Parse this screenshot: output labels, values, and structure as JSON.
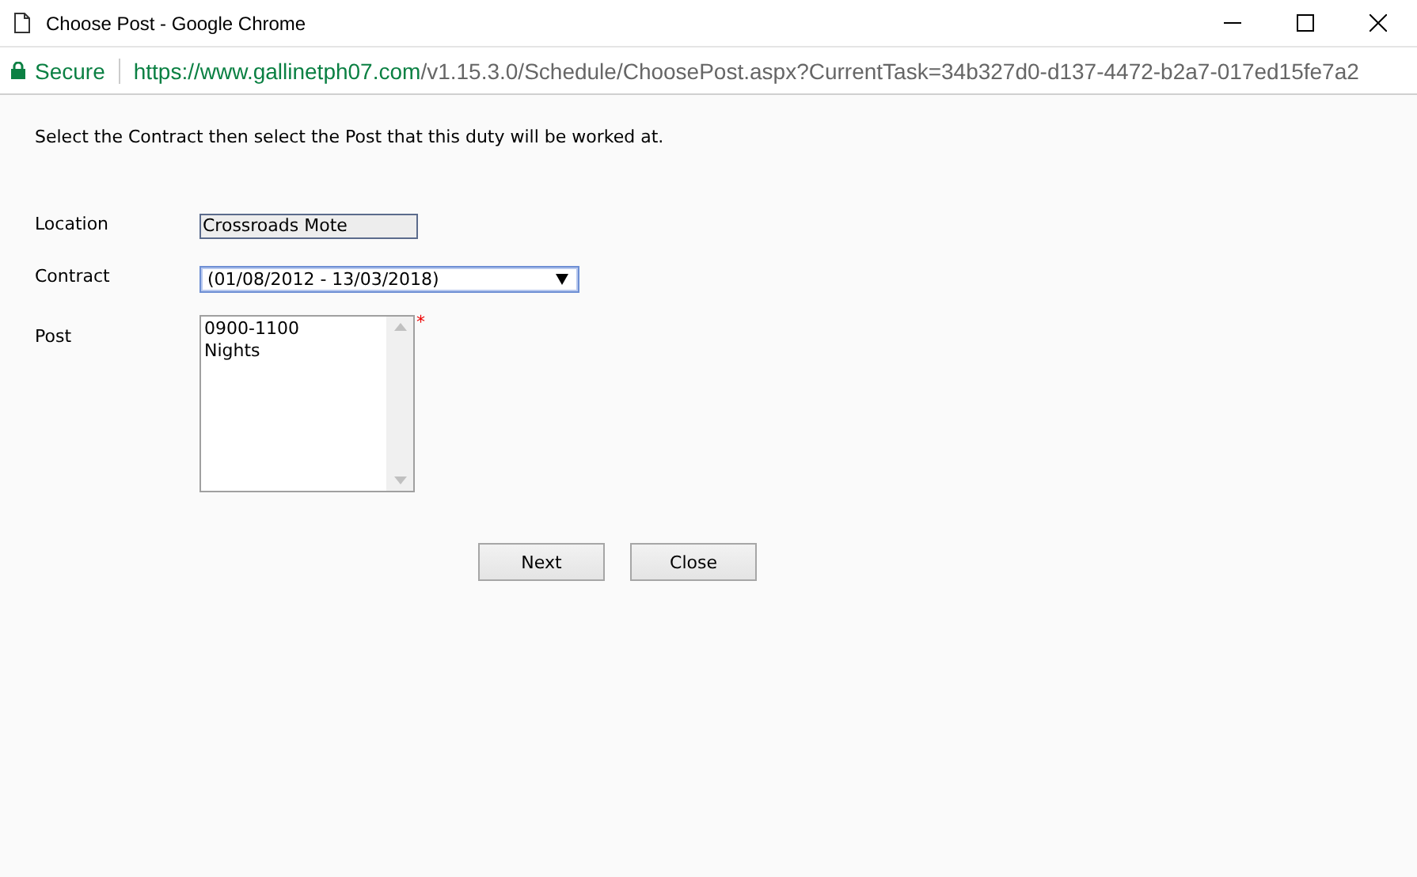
{
  "window": {
    "title": "Choose Post - Google Chrome"
  },
  "address_bar": {
    "security": "Secure",
    "url_host": "https://www.gallinetph07.com",
    "url_path": "/v1.15.3.0/Schedule/ChoosePost.aspx?CurrentTask=34b327d0-d137-4472-b2a7-017ed15fe7a2"
  },
  "instruction": "Select the Contract then select the Post that this duty will be worked at.",
  "form": {
    "location": {
      "label": "Location",
      "value": "Crossroads Mote",
      "disabled": true
    },
    "contract": {
      "label": "Contract",
      "value": "(01/08/2012 - 13/03/2018)",
      "focused": true
    },
    "post": {
      "label": "Post",
      "required_mark": "*",
      "options": [
        {
          "label": "0900-1100",
          "selected": false
        },
        {
          "label": "Nights",
          "selected": false
        }
      ]
    }
  },
  "buttons": [
    {
      "label": "Next"
    },
    {
      "label": "Close"
    }
  ]
}
